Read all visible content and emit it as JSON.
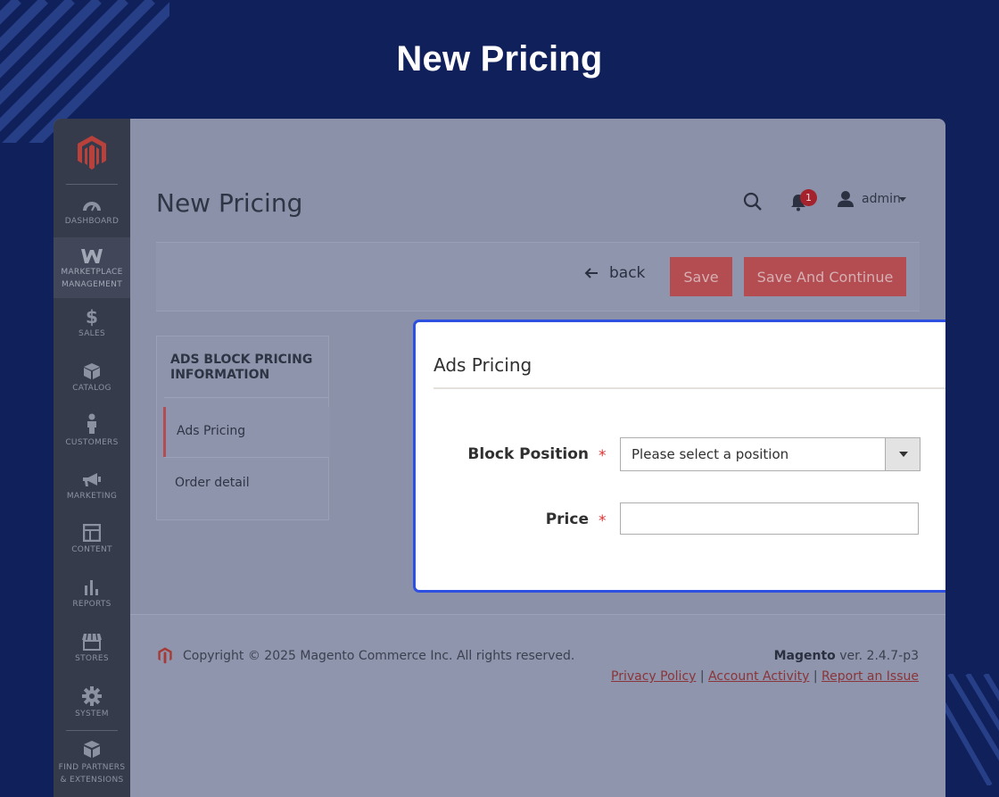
{
  "hero": {
    "title": "New Pricing"
  },
  "sidebar": {
    "items": [
      {
        "label": "DASHBOARD"
      },
      {
        "label": "MARKETPLACE MANAGEMENT"
      },
      {
        "label": "SALES"
      },
      {
        "label": "CATALOG"
      },
      {
        "label": "CUSTOMERS"
      },
      {
        "label": "MARKETING"
      },
      {
        "label": "CONTENT"
      },
      {
        "label": "REPORTS"
      },
      {
        "label": "STORES"
      },
      {
        "label": "SYSTEM"
      },
      {
        "label": "FIND PARTNERS & EXTENSIONS"
      }
    ]
  },
  "header": {
    "page_title": "New Pricing",
    "notifications_count": "1",
    "user": "admin"
  },
  "actions": {
    "back": "back",
    "save": "Save",
    "save_continue": "Save And Continue"
  },
  "tabs": {
    "title": "ADS BLOCK PRICING INFORMATION",
    "items": [
      {
        "label": "Ads Pricing",
        "active": true
      },
      {
        "label": "Order detail",
        "active": false
      }
    ]
  },
  "form": {
    "section_title": "Ads Pricing",
    "block_position": {
      "label": "Block Position",
      "required_mark": "*",
      "selected": "Please select a position"
    },
    "price": {
      "label": "Price",
      "required_mark": "*",
      "value": ""
    }
  },
  "footer": {
    "copyright": "Copyright © 2025 Magento Commerce Inc. All rights reserved.",
    "brand": "Magento",
    "version": " ver. 2.4.7-p3",
    "links": [
      "Privacy Policy",
      "Account Activity",
      "Report an Issue"
    ],
    "sep": "|"
  },
  "colors": {
    "background": "#10205a",
    "accent": "#b34d52",
    "highlight_border": "#2e50e0"
  }
}
